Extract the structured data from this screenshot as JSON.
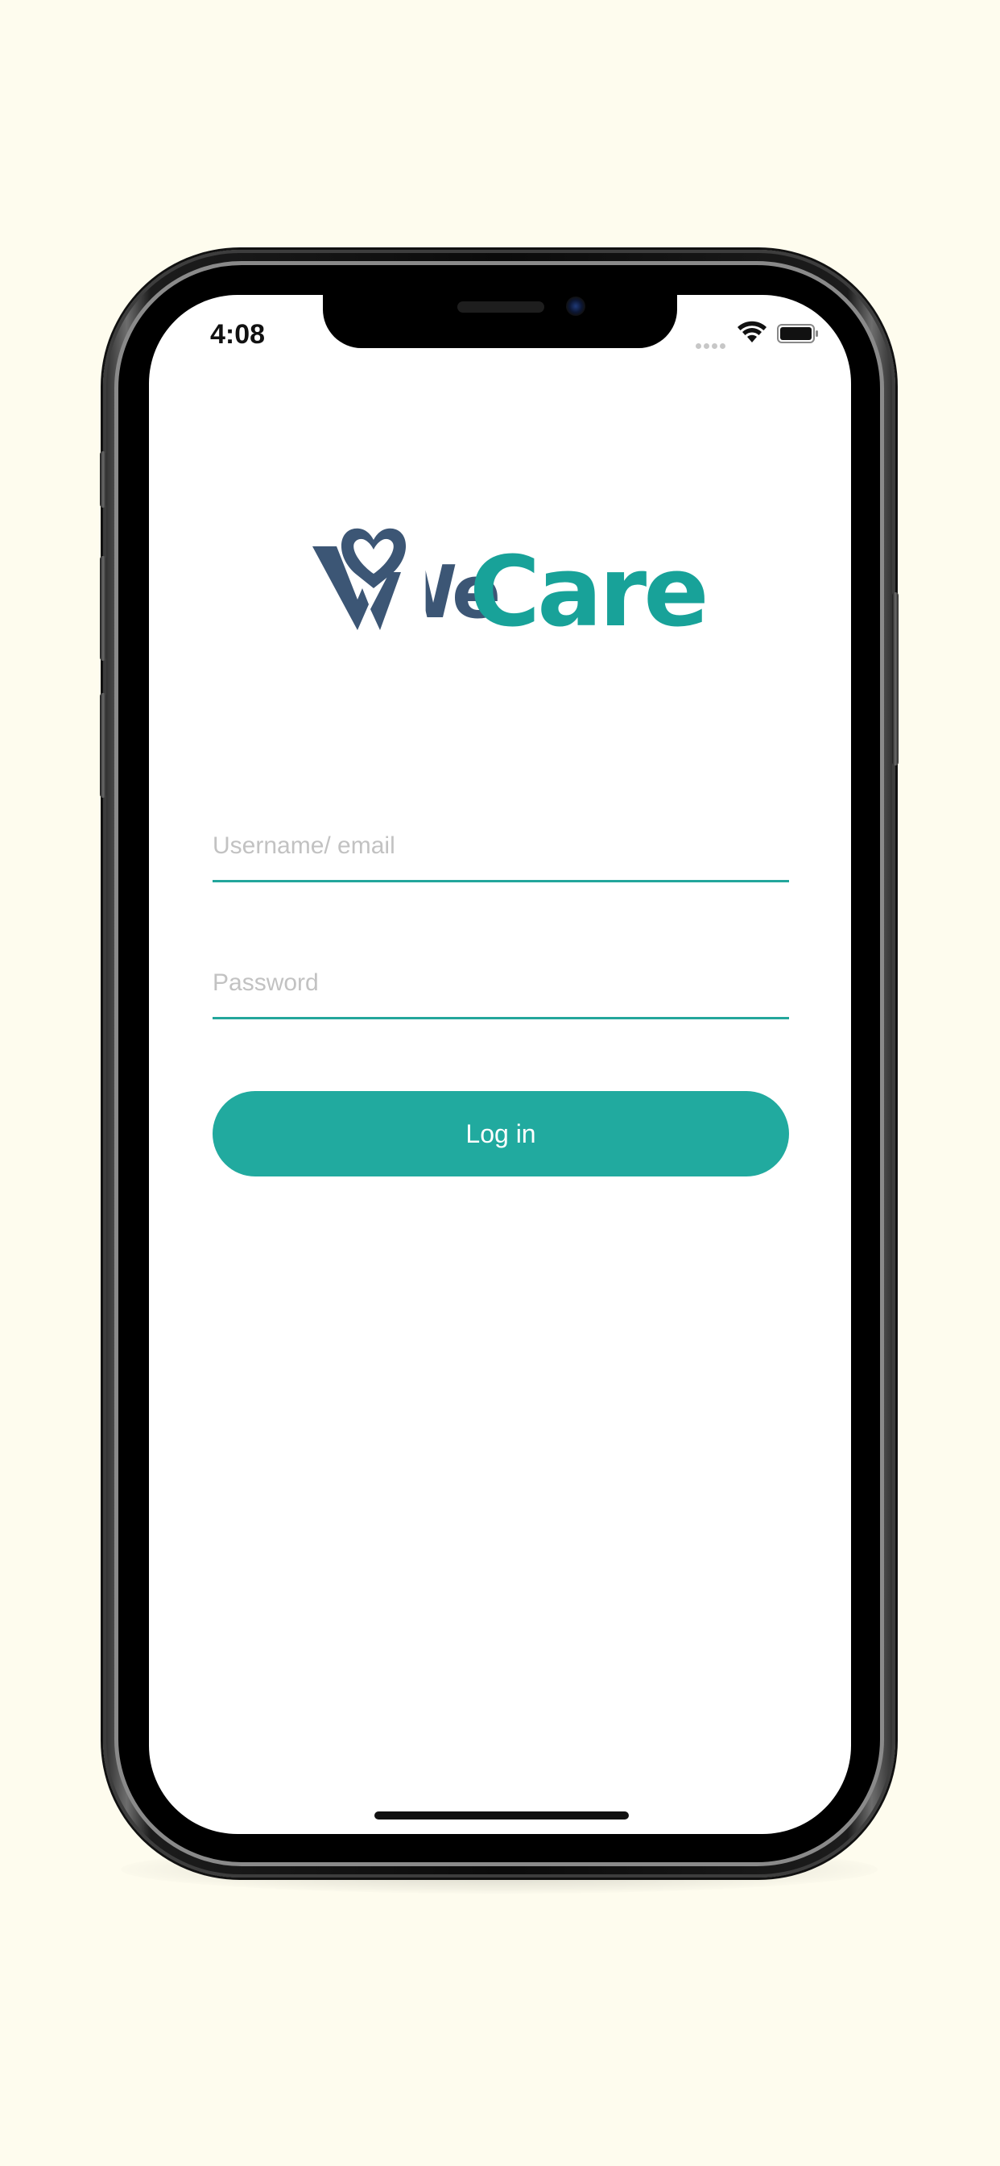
{
  "status_bar": {
    "time": "4:08",
    "icons": [
      "signal-dots-icon",
      "wifi-icon",
      "battery-icon"
    ]
  },
  "logo": {
    "text_part1": "We",
    "text_part2": "Care",
    "primary_color": "#3c5675",
    "accent_color": "#18a299"
  },
  "form": {
    "username": {
      "placeholder": "Username/ email",
      "value": ""
    },
    "password": {
      "placeholder": "Password",
      "value": ""
    },
    "login_label": "Log in"
  },
  "colors": {
    "background": "#fefcee",
    "accent": "#21aa9f",
    "input_underline": "#23a69c",
    "placeholder": "#c2c2c2"
  }
}
